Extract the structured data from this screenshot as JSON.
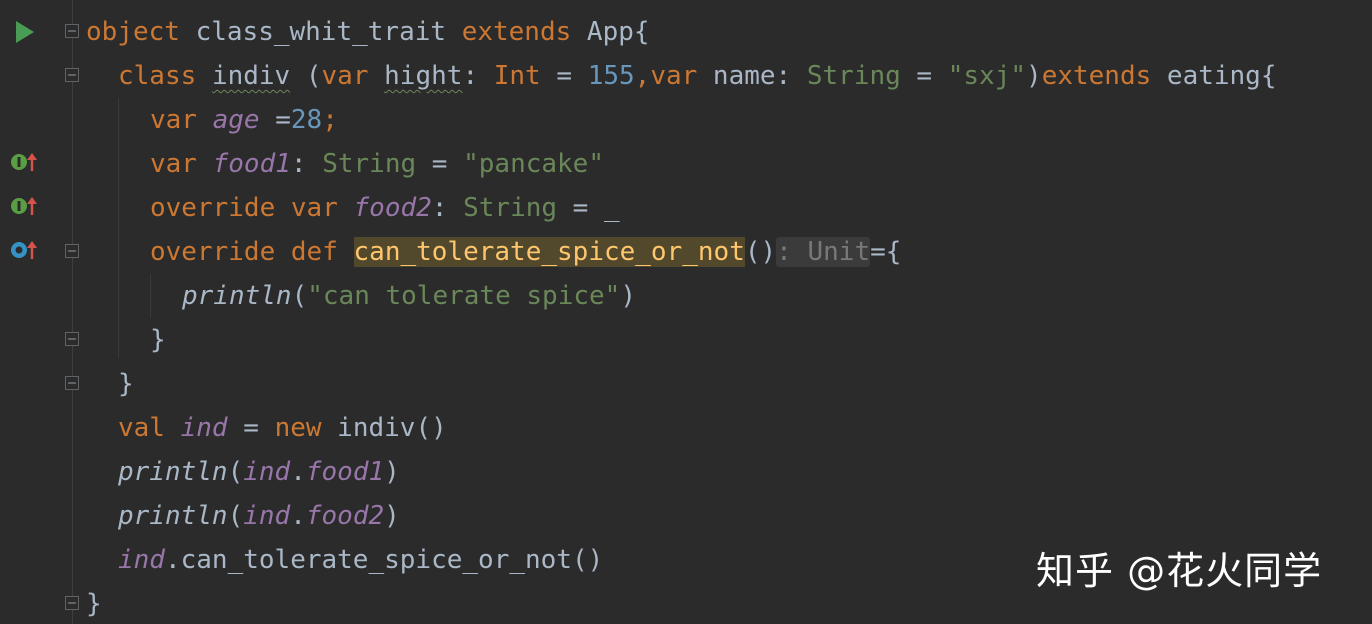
{
  "editor": {
    "lines": [
      {
        "id": "l1",
        "tokens": [
          [
            "kw",
            "object"
          ],
          [
            "plain",
            " class_whit_trait "
          ],
          [
            "kw",
            "extends"
          ],
          [
            "plain",
            " App{"
          ]
        ]
      },
      {
        "id": "l2",
        "tokens": [
          [
            "kw",
            "class"
          ],
          [
            "plain",
            " "
          ],
          [
            "plain wavy",
            "indiv"
          ],
          [
            "plain",
            " ("
          ],
          [
            "kw",
            "var"
          ],
          [
            "plain",
            " "
          ],
          [
            "plain wavy",
            "hight"
          ],
          [
            "plain",
            ": "
          ],
          [
            "kw",
            "Int"
          ],
          [
            "plain",
            " = "
          ],
          [
            "num",
            "155"
          ],
          [
            "kw",
            ","
          ],
          [
            "kw",
            "var"
          ],
          [
            "plain",
            " name: "
          ],
          [
            "type",
            "String"
          ],
          [
            "plain",
            " = "
          ],
          [
            "str",
            "\"sxj\""
          ],
          [
            "plain",
            ")"
          ],
          [
            "kw",
            "extends"
          ],
          [
            "plain",
            " eating{"
          ]
        ]
      },
      {
        "id": "l3",
        "tokens": [
          [
            "kw",
            "var"
          ],
          [
            "plain",
            " "
          ],
          [
            "field",
            "age"
          ],
          [
            "plain",
            " ="
          ],
          [
            "num",
            "28"
          ],
          [
            "kw",
            ";"
          ]
        ]
      },
      {
        "id": "l4",
        "tokens": [
          [
            "kw",
            "var"
          ],
          [
            "plain",
            " "
          ],
          [
            "field",
            "food1"
          ],
          [
            "plain",
            ": "
          ],
          [
            "type",
            "String"
          ],
          [
            "plain",
            " = "
          ],
          [
            "str",
            "\"pancake\""
          ]
        ]
      },
      {
        "id": "l5",
        "tokens": [
          [
            "kw",
            "override"
          ],
          [
            "plain",
            " "
          ],
          [
            "kw",
            "var"
          ],
          [
            "plain",
            " "
          ],
          [
            "field",
            "food2"
          ],
          [
            "plain",
            ": "
          ],
          [
            "type",
            "String"
          ],
          [
            "plain",
            " = _"
          ]
        ]
      },
      {
        "id": "l6",
        "tokens": [
          [
            "kw",
            "override"
          ],
          [
            "plain",
            " "
          ],
          [
            "kw",
            "def"
          ],
          [
            "plain",
            " "
          ],
          [
            "hl",
            "can_tolerate_spice_or_not"
          ],
          [
            "plain",
            "()"
          ],
          [
            "hint",
            ": Unit"
          ],
          [
            "plain",
            "={"
          ]
        ]
      },
      {
        "id": "l7",
        "tokens": [
          [
            "plain italic",
            "println"
          ],
          [
            "plain",
            "("
          ],
          [
            "str",
            "\"can tolerate spice\""
          ],
          [
            "plain",
            ")"
          ]
        ]
      },
      {
        "id": "l8",
        "tokens": [
          [
            "plain",
            "}"
          ]
        ]
      },
      {
        "id": "l9",
        "tokens": [
          [
            "plain",
            "}"
          ]
        ]
      },
      {
        "id": "l10",
        "tokens": [
          [
            "kw",
            "val"
          ],
          [
            "plain",
            " "
          ],
          [
            "field",
            "ind"
          ],
          [
            "plain",
            " = "
          ],
          [
            "kw",
            "new"
          ],
          [
            "plain",
            " indiv()"
          ]
        ]
      },
      {
        "id": "l11",
        "tokens": [
          [
            "plain italic",
            "println"
          ],
          [
            "plain",
            "("
          ],
          [
            "field",
            "ind"
          ],
          [
            "plain",
            "."
          ],
          [
            "field",
            "food1"
          ],
          [
            "plain",
            ")"
          ]
        ]
      },
      {
        "id": "l12",
        "tokens": [
          [
            "plain italic",
            "println"
          ],
          [
            "plain",
            "("
          ],
          [
            "field",
            "ind"
          ],
          [
            "plain",
            "."
          ],
          [
            "field",
            "food2"
          ],
          [
            "plain",
            ")"
          ]
        ]
      },
      {
        "id": "l13",
        "tokens": [
          [
            "field",
            "ind"
          ],
          [
            "plain",
            ".can_tolerate_spice_or_not()"
          ]
        ]
      },
      {
        "id": "l14",
        "tokens": [
          [
            "plain",
            "}"
          ]
        ]
      }
    ]
  },
  "gutter": {
    "run_icon": "run-triangle-icon",
    "markers": [
      "implements-up-icon",
      "implements-up-icon",
      "overrides-up-icon"
    ],
    "colors": {
      "run": "#499c54",
      "implements": "#5a9e44",
      "overrides": "#3592c4",
      "arrow": "#d4534b"
    }
  },
  "watermark": {
    "text": "知乎 @花火同学"
  }
}
